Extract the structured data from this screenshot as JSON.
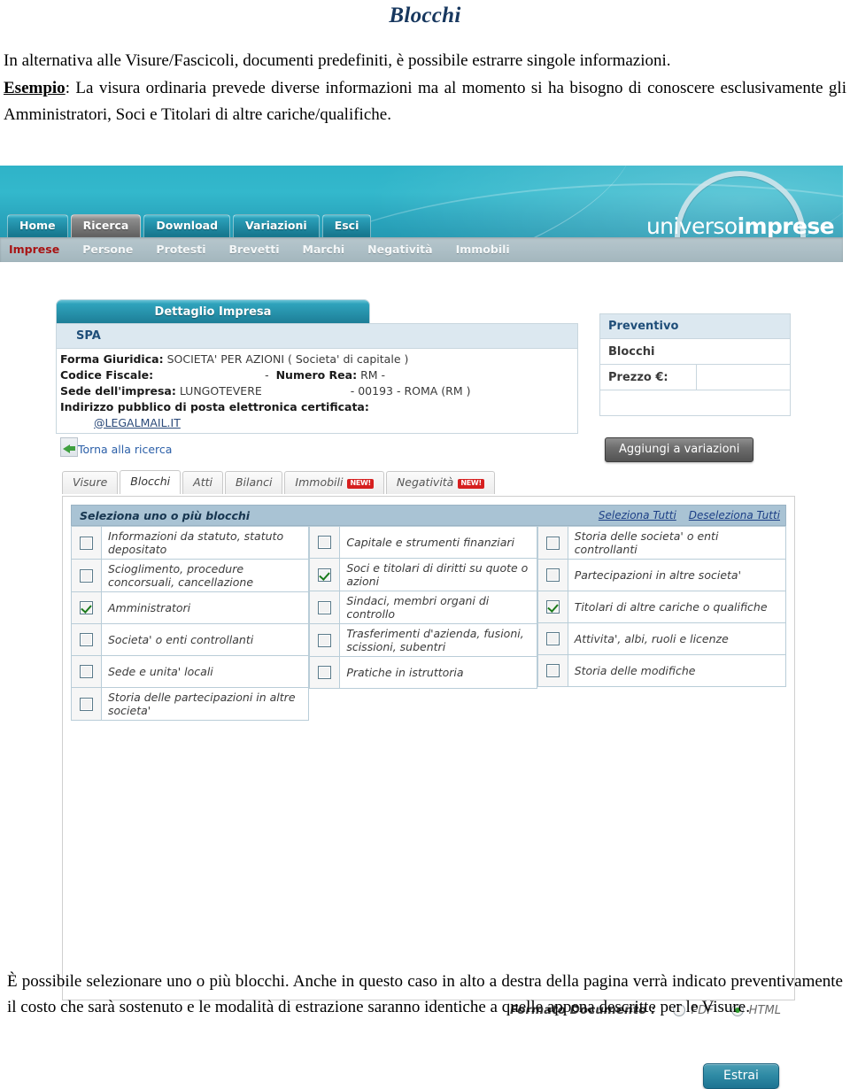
{
  "document": {
    "title": "Blocchi",
    "intro_line1": "In alternativa alle Visure/Fascicoli, documenti predefiniti, è possibile estrarre singole informazioni.",
    "intro_label": "Esempio",
    "intro_line2": ": La visura ordinaria prevede diverse informazioni ma al momento si ha bisogno di conoscere esclusivamente gli Amministratori, Soci e Titolari di altre cariche/qualifiche.",
    "bottom_text": "È possibile selezionare uno o più blocchi. Anche in questo caso in alto a destra della pagina verrà indicato preventivamente il costo che sarà sostenuto e le modalità di estrazione saranno identiche a quelle appena descritte per le Visure."
  },
  "app": {
    "logo_thin": "universo",
    "logo_bold": "imprese",
    "primary_nav": [
      {
        "label": "Home",
        "active": false
      },
      {
        "label": "Ricerca",
        "active": true
      },
      {
        "label": "Download",
        "active": false
      },
      {
        "label": "Variazioni",
        "active": false
      },
      {
        "label": "Esci",
        "active": false
      }
    ],
    "secondary_nav": [
      {
        "label": "Imprese",
        "active": true
      },
      {
        "label": "Persone",
        "active": false
      },
      {
        "label": "Protesti",
        "active": false
      },
      {
        "label": "Brevetti",
        "active": false
      },
      {
        "label": "Marchi",
        "active": false
      },
      {
        "label": "Negatività",
        "active": false
      },
      {
        "label": "Immobili",
        "active": false
      }
    ],
    "detail": {
      "tab_label": "Dettaglio Impresa",
      "company_name": "SPA",
      "row_forma_label": "Forma Giuridica:",
      "row_forma_value": "SOCIETA' PER AZIONI ( Societa' di capitale )",
      "row_cf_label": "Codice Fiscale:",
      "row_cf_value": "-",
      "row_rea_label": "Numero Rea:",
      "row_rea_value": "RM -",
      "row_sede_label": "Sede dell'impresa:",
      "row_sede_value": "LUNGOTEVERE",
      "row_sede_value2": "- 00193 - ROMA (RM )",
      "row_pec_label": "Indirizzo pubblico di posta elettronica certificata:",
      "row_pec_value": "@LEGALMAIL.IT"
    },
    "preventivo": {
      "title": "Preventivo",
      "type_label": "Blocchi",
      "price_label": "Prezzo €:",
      "price_value": ""
    },
    "back_link": "Torna alla ricerca",
    "add_variations_button": "Aggiungi a variazioni",
    "subtabs": [
      {
        "label": "Visure",
        "active": false,
        "badge": ""
      },
      {
        "label": "Blocchi",
        "active": true,
        "badge": ""
      },
      {
        "label": "Atti",
        "active": false,
        "badge": ""
      },
      {
        "label": "Bilanci",
        "active": false,
        "badge": ""
      },
      {
        "label": "Immobili",
        "active": false,
        "badge": "NEW!"
      },
      {
        "label": "Negatività",
        "active": false,
        "badge": "NEW!"
      }
    ],
    "blocks": {
      "header_title": "Seleziona uno o più blocchi",
      "select_all": "Seleziona Tutti",
      "deselect_all": "Deseleziona Tutti",
      "column1": [
        {
          "label": "Informazioni da statuto, statuto depositato",
          "checked": false
        },
        {
          "label": "Scioglimento, procedure concorsuali, cancellazione",
          "checked": false
        },
        {
          "label": "Amministratori",
          "checked": true
        },
        {
          "label": "Societa' o enti controllanti",
          "checked": false
        },
        {
          "label": "Sede e unita' locali",
          "checked": false
        },
        {
          "label": "Storia delle partecipazioni in altre societa'",
          "checked": false
        }
      ],
      "column2": [
        {
          "label": "Capitale e strumenti finanziari",
          "checked": false
        },
        {
          "label": "Soci e titolari di diritti su quote o azioni",
          "checked": true
        },
        {
          "label": "Sindaci, membri organi di controllo",
          "checked": false
        },
        {
          "label": "Trasferimenti d'azienda, fusioni, scissioni, subentri",
          "checked": false
        },
        {
          "label": "Pratiche in istruttoria",
          "checked": false
        }
      ],
      "column3": [
        {
          "label": "Storia delle societa' o enti controllanti",
          "checked": false
        },
        {
          "label": "Partecipazioni in altre societa'",
          "checked": false
        },
        {
          "label": "Titolari di altre cariche o qualifiche",
          "checked": true
        },
        {
          "label": "Attivita', albi, ruoli e licenze",
          "checked": false
        },
        {
          "label": "Storia delle modifiche",
          "checked": false
        }
      ]
    },
    "format": {
      "label": "Formato Documento :",
      "options": [
        {
          "label": "PDF",
          "selected": false
        },
        {
          "label": "HTML",
          "selected": true
        }
      ]
    },
    "extract_button": "Estrai"
  },
  "colors": {
    "banner_teal": "#2fb3c8",
    "accent_blue": "#1f4e79",
    "active_red": "#a81414",
    "check_green": "#1a7a1a",
    "link_blue": "#1c3f86",
    "title_navy": "#17375e"
  }
}
